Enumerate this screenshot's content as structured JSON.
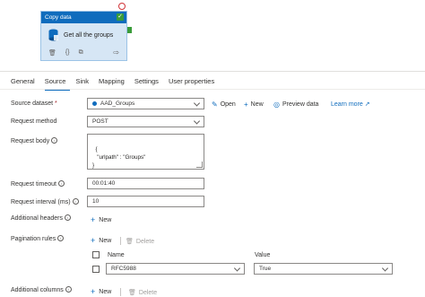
{
  "canvas": {
    "activity": {
      "type_label": "Copy data",
      "name": "Get all the groups"
    }
  },
  "tabs": [
    {
      "label": "General"
    },
    {
      "label": "Source"
    },
    {
      "label": "Sink"
    },
    {
      "label": "Mapping"
    },
    {
      "label": "Settings"
    },
    {
      "label": "User properties"
    }
  ],
  "form": {
    "source_dataset": {
      "label": "Source dataset",
      "required_mark": "*",
      "value": "AAD_Groups",
      "open_label": "Open",
      "new_label": "New",
      "preview_label": "Preview data",
      "learn_more": "Learn more"
    },
    "request_method": {
      "label": "Request method",
      "value": "POST"
    },
    "request_body": {
      "label": "Request body",
      "value": "{\n   \"urlpath\" : \"Groups\"\n}"
    },
    "request_timeout": {
      "label": "Request timeout",
      "value": "00:01:40"
    },
    "request_interval": {
      "label": "Request interval (ms)",
      "value": "10"
    },
    "additional_headers": {
      "label": "Additional headers",
      "new_label": "New"
    },
    "pagination_rules": {
      "label": "Pagination rules",
      "new_label": "New",
      "delete_label": "Delete",
      "columns": {
        "name": "Name",
        "value": "Value"
      },
      "rows": [
        {
          "name": "RFC5988",
          "value": "True"
        }
      ]
    },
    "additional_columns": {
      "label": "Additional columns",
      "new_label": "New",
      "delete_label": "Delete"
    }
  }
}
